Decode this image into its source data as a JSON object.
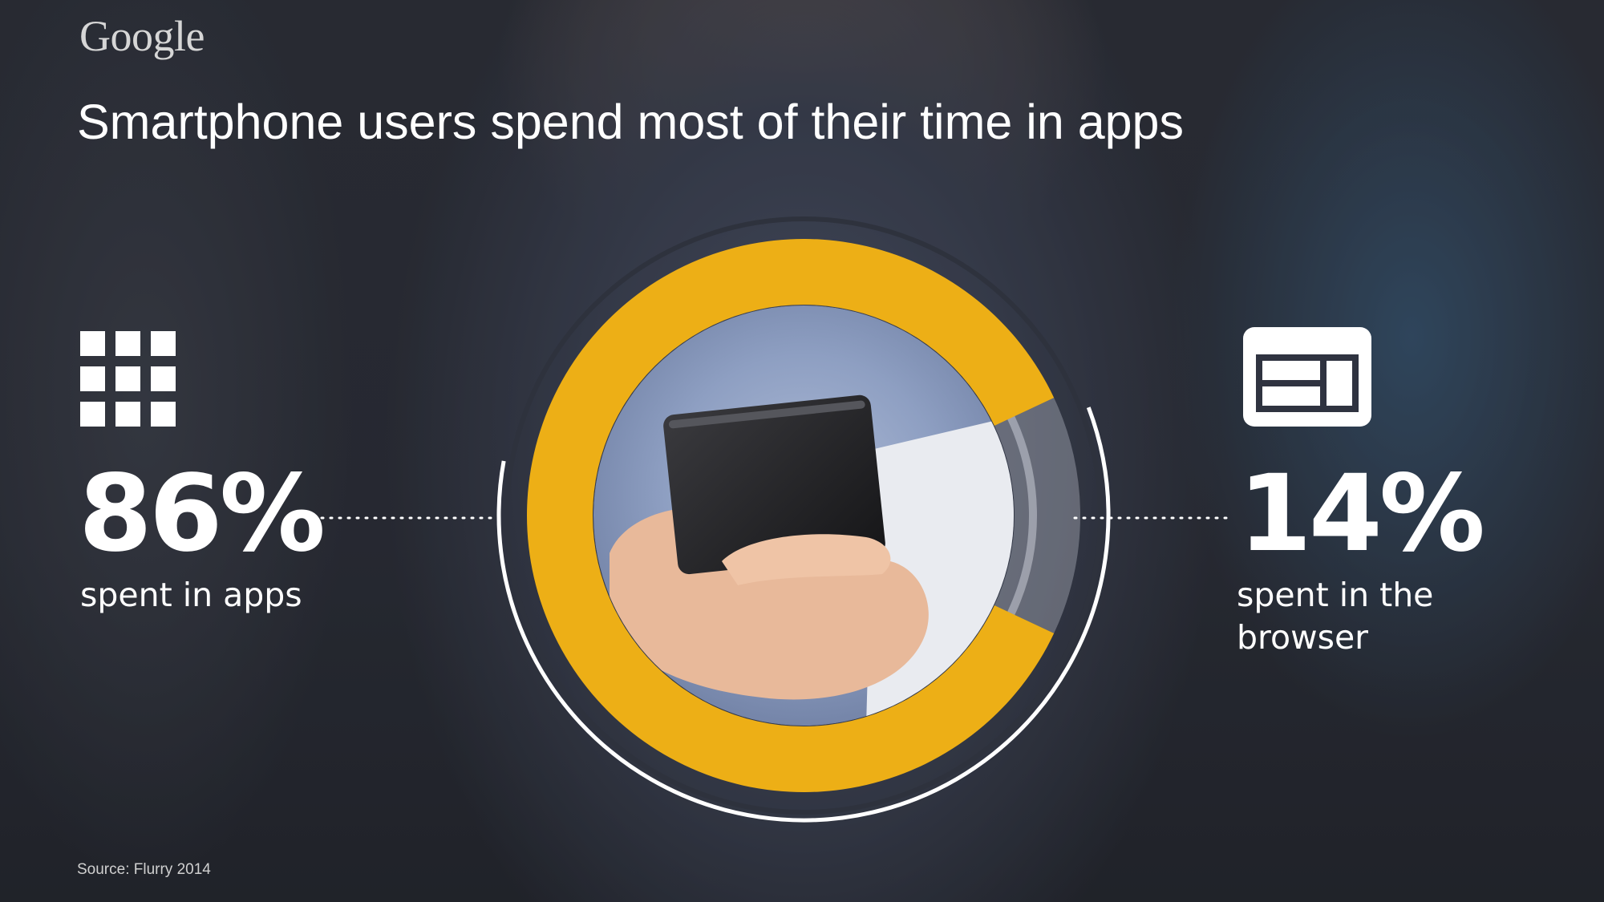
{
  "brand": {
    "logo_text": "Google"
  },
  "header": {
    "title": "Smartphone users spend most of their time in apps"
  },
  "stats": {
    "apps": {
      "value": "86%",
      "caption": "spent in apps",
      "icon": "apps-grid-icon"
    },
    "browser": {
      "value": "14%",
      "caption": "spent in the browser",
      "icon": "browser-window-icon"
    }
  },
  "footer": {
    "source": "Source: Flurry 2014"
  },
  "colors": {
    "accent": "#EDAF16",
    "ring": "#FFFFFF",
    "remainder": "#C9CCD6"
  },
  "chart_data": {
    "type": "pie",
    "style": "donut",
    "title": "Smartphone users spend most of their time in apps",
    "series": [
      {
        "name": "spent in apps",
        "value": 86
      },
      {
        "name": "spent in the browser",
        "value": 14
      }
    ],
    "unit": "%",
    "legend": "none",
    "grid": false
  }
}
